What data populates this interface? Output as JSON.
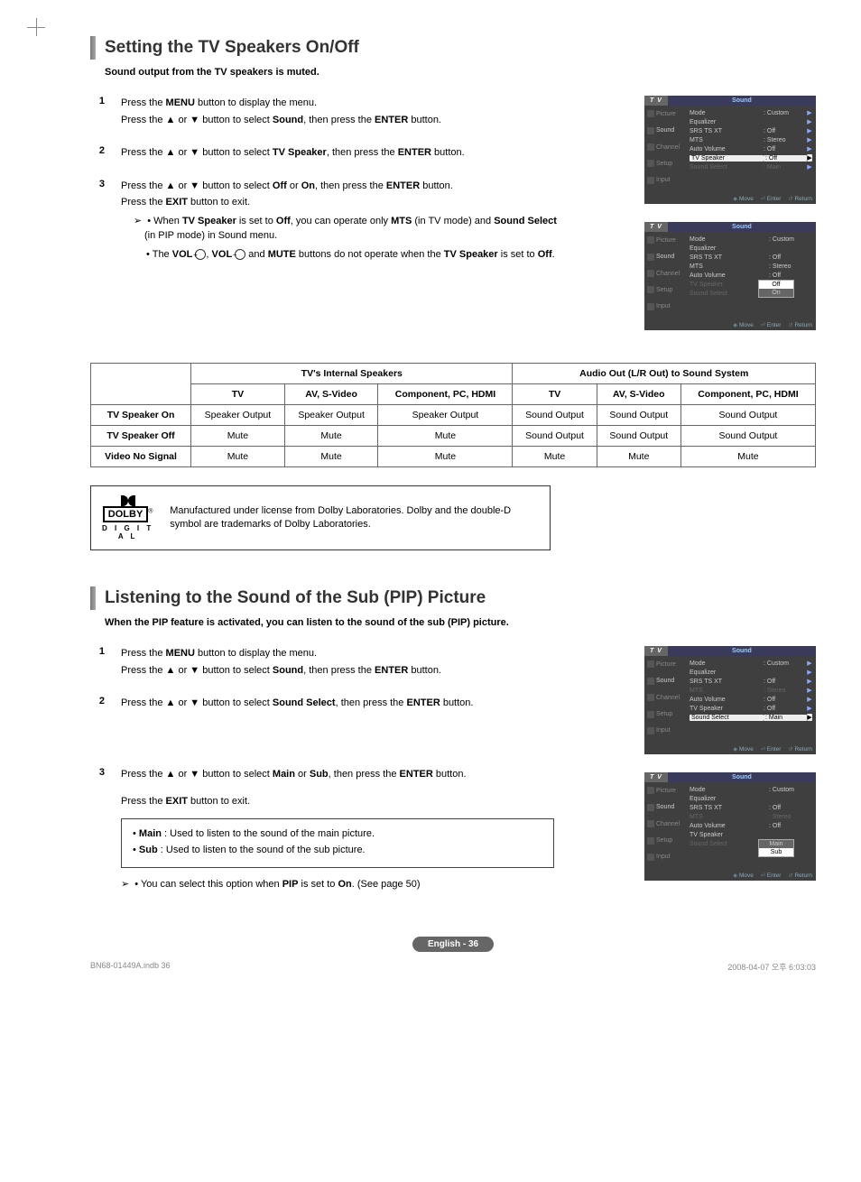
{
  "section1": {
    "title": "Setting the TV Speakers On/Off",
    "sub": "Sound output from the TV speakers is muted.",
    "step1a": "Press the ",
    "step1b": " button to display the menu.",
    "step1c": "Press the ▲ or ▼ button to select ",
    "step1d": ", then press the ",
    "step1e": " button.",
    "menu": "MENU",
    "enter": "ENTER",
    "sound": "Sound",
    "step2a": "Press the ▲ or ▼ button to select ",
    "tvspk": "TV Speaker",
    "step3a": "Press the ▲ or ▼ button to select ",
    "off": "Off",
    "or": " or ",
    "on": "On",
    "step3b": "Press the ",
    "exit": "EXIT",
    "step3c": " button to exit.",
    "note1": "When ",
    "note1b": " is set to ",
    "note1c": ", you can operate only ",
    "mts": "MTS",
    "note1d": " (in TV mode) and ",
    "ss": "Sound Select",
    "note1e": " (in PIP mode) in Sound menu.",
    "note2a": "The ",
    "vol": "VOL",
    "note2b": " and ",
    "mute": "MUTE",
    "note2c": " buttons do not operate when the ",
    "note2d": " is set to ",
    "dolby_text": "Manufactured under license from Dolby Laboratories. Dolby and the double-D symbol are trademarks of Dolby Laboratories.",
    "dolby_brand": "DOLBY",
    "dolby_sub": "D I G I T A L"
  },
  "table": {
    "h1": "TV's Internal Speakers",
    "h2": "Audio Out (L/R Out) to Sound System",
    "c_tv": "TV",
    "c_av": "AV, S-Video",
    "c_comp": "Component, PC, HDMI",
    "r1": "TV Speaker On",
    "r2": "TV Speaker Off",
    "r3": "Video No Signal",
    "so": "Speaker Output",
    "sndo": "Sound Output",
    "mute": "Mute"
  },
  "section2": {
    "title": "Listening to the Sound of the Sub (PIP) Picture",
    "sub": "When the PIP feature is activated, you can listen to the sound of the sub (PIP) picture.",
    "step3_main": "Main",
    "step3_sub": "Sub",
    "mainnote": " : Used to listen to the sound of the main picture.",
    "subnote": " : Used to listen to the sound of the sub picture.",
    "pipnote1": "You can select this option when ",
    "pip": "PIP",
    "pipnote2": " is set to ",
    "pipnote3": ". (See page 50)"
  },
  "osd": {
    "tv": "T V",
    "sound": "Sound",
    "nav": [
      "Picture",
      "Sound",
      "Channel",
      "Setup",
      "Input"
    ],
    "rows_mode": "Mode",
    "val_mode": ": Custom",
    "rows_eq": "Equalizer",
    "val_eq": "",
    "rows_srs": "SRS TS XT",
    "val_srs": ": Off",
    "rows_mts": "MTS",
    "val_mts": ": Stereo",
    "rows_av": "Auto Volume",
    "val_av": ": Off",
    "rows_tvspk": "TV Speaker",
    "val_tvspk": ": Off",
    "rows_ss": "Sound Select",
    "val_ss": ": Main",
    "foot_move": "Move",
    "foot_enter": "Enter",
    "foot_return": "Return",
    "pop_off": "Off",
    "pop_on": "On",
    "pop_main": "Main",
    "pop_sub": "Sub"
  },
  "page": "English - 36",
  "footer": {
    "left": "BN68-01449A.indb   36",
    "right": "2008-04-07   오후 6:03:03"
  }
}
